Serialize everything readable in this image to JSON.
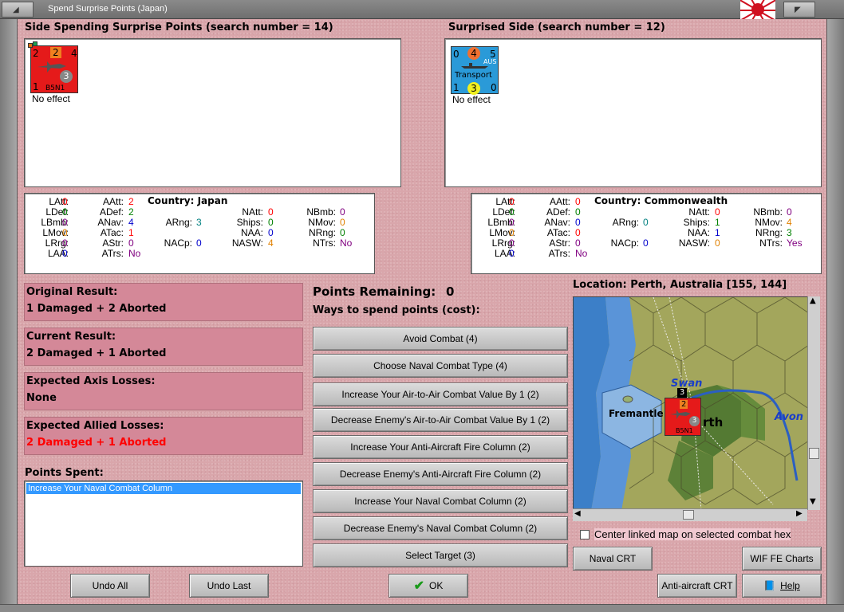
{
  "window": {
    "title": "Spend Surprise Points (Japan)"
  },
  "attacker": {
    "header": "Side Spending Surprise Points (search number = 14)",
    "unit": {
      "tl": "2",
      "tm": "2",
      "tr": "4",
      "bl": "1",
      "br": "3",
      "name": "B5N1",
      "effect": "No effect"
    },
    "stats": {
      "latt_l": "LAtt:",
      "latt": "0",
      "ldef_l": "LDef:",
      "ldef": "0",
      "lbmb_l": "LBmb:",
      "lbmb": "0",
      "lmov_l": "LMov:",
      "lmov": "0",
      "lrrg_l": "LRrg:",
      "lrrg": "0",
      "laa_l": "LAA:",
      "laa": "0",
      "aatt_l": "AAtt:",
      "aatt": "2",
      "adef_l": "ADef:",
      "adef": "2",
      "anav_l": "ANav:",
      "anav": "4",
      "atac_l": "ATac:",
      "atac": "1",
      "astr_l": "AStr:",
      "astr": "0",
      "atrs_l": "ATrs:",
      "atrs": "No",
      "country": "Country: Japan",
      "arng_l": "ARng:",
      "arng": "3",
      "nacp_l": "NACp:",
      "nacp": "0",
      "natt_l": "NAtt:",
      "natt": "0",
      "ships_l": "Ships:",
      "ships": "0",
      "naa_l": "NAA:",
      "naa": "0",
      "nasw_l": "NASW:",
      "nasw": "4",
      "nbmb_l": "NBmb:",
      "nbmb": "0",
      "nmov_l": "NMov:",
      "nmov": "0",
      "nrng_l": "NRng:",
      "nrng": "0",
      "ntrs_l": "NTrs:",
      "ntrs": "No"
    }
  },
  "defender": {
    "header": "Surprised Side (search number = 12)",
    "unit": {
      "tl": "0",
      "tm": "4",
      "tr": "5",
      "nation": "AUS",
      "type": "Transport",
      "bl": "1",
      "bm": "3",
      "br": "0",
      "effect": "No effect"
    },
    "stats": {
      "latt_l": "LAtt:",
      "latt": "0",
      "ldef_l": "LDef:",
      "ldef": "0",
      "lbmb_l": "LBmb:",
      "lbmb": "0",
      "lmov_l": "LMov:",
      "lmov": "0",
      "lrrg_l": "LRrg:",
      "lrrg": "0",
      "laa_l": "LAA:",
      "laa": "0",
      "aatt_l": "AAtt:",
      "aatt": "0",
      "adef_l": "ADef:",
      "adef": "0",
      "anav_l": "ANav:",
      "anav": "0",
      "atac_l": "ATac:",
      "atac": "0",
      "astr_l": "AStr:",
      "astr": "0",
      "atrs_l": "ATrs:",
      "atrs": "No",
      "country": "Country: Commonwealth",
      "arng_l": "ARng:",
      "arng": "0",
      "nacp_l": "NACp:",
      "nacp": "0",
      "natt_l": "NAtt:",
      "natt": "0",
      "ships_l": "Ships:",
      "ships": "1",
      "naa_l": "NAA:",
      "naa": "1",
      "nasw_l": "NASW:",
      "nasw": "0",
      "nbmb_l": "NBmb:",
      "nbmb": "0",
      "nmov_l": "NMov:",
      "nmov": "4",
      "nrng_l": "NRng:",
      "nrng": "3",
      "ntrs_l": "NTrs:",
      "ntrs": "Yes"
    }
  },
  "results": {
    "original_label": "Original Result:",
    "original": "1 Damaged + 2 Aborted",
    "current_label": "Current Result:",
    "current": "2 Damaged + 1 Aborted",
    "axis_label": "Expected Axis Losses:",
    "axis": "None",
    "allied_label": "Expected Allied Losses:",
    "allied": "2 Damaged + 1 Aborted"
  },
  "spent": {
    "label": "Points Spent:",
    "items": [
      "Increase Your Naval Combat Column"
    ]
  },
  "points": {
    "label": "Points Remaining:",
    "value": "0",
    "ways_label": "Ways to spend points (cost):"
  },
  "ways": [
    "Avoid Combat (4)",
    "Choose Naval Combat Type (4)",
    "Increase Your Air-to-Air Combat Value By 1 (2)",
    "Decrease Enemy's Air-to-Air Combat Value By 1 (2)",
    "Increase Your Anti-Aircraft Fire Column (2)",
    "Decrease Enemy's Anti-Aircraft Fire Column (2)",
    "Increase Your Naval Combat Column (2)",
    "Decrease Enemy's Naval Combat Column (2)",
    "Select Target (3)"
  ],
  "map": {
    "location": "Location: Perth, Australia [155, 144]",
    "labels": {
      "fremantle": "Fremantle",
      "perth": "rth",
      "swan": "Swan",
      "avon": "Avon"
    },
    "stack_count": "3",
    "unit": {
      "tm": "2",
      "br": "3",
      "name": "B5N1"
    }
  },
  "center_linked": "Center linked map on selected combat hex",
  "buttons": {
    "undo_all": "Undo All",
    "undo_last": "Undo Last",
    "ok": "OK",
    "naval_crt": "Naval CRT",
    "wif_charts": "WIF FE Charts",
    "aa_crt": "Anti-aircraft CRT",
    "help": "Help"
  },
  "colors": {
    "red_value": "#ff0000",
    "green_value": "#008000",
    "blue_value": "#0000cc",
    "teal_value": "#008080",
    "purple_value": "#800080",
    "orange_value": "#e08000"
  }
}
